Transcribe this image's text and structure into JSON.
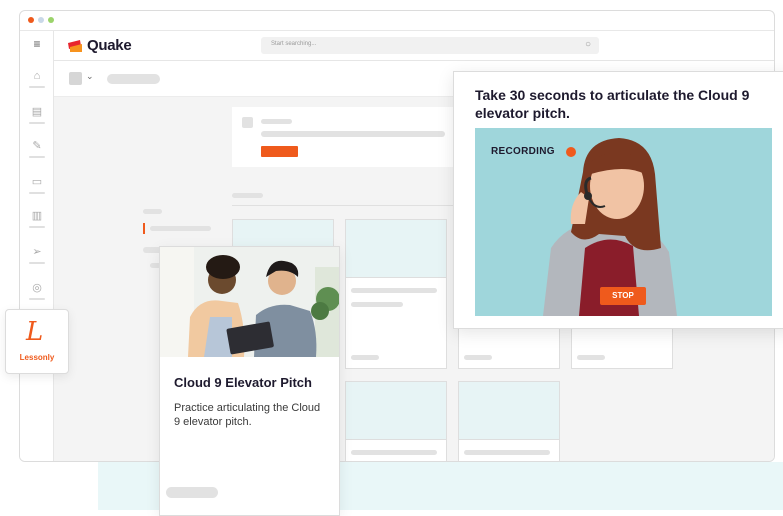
{
  "header": {
    "logo_text": "Quake",
    "search_placeholder": "Start searching..."
  },
  "hero_card": {
    "title": "Cloud 9 Elevator Pitch",
    "description": "Practice articulating the Cloud 9 elevator pitch."
  },
  "lessonly": {
    "logo_letter": "L",
    "label": "Lessonly"
  },
  "recording_panel": {
    "title": "Take 30 seconds to articulate the Cloud 9 elevator pitch.",
    "status_label": "RECORDING",
    "stop_label": "STOP"
  },
  "colors": {
    "brand_orange": "#ef5a1c",
    "brand_red": "#e8262d",
    "video_bg": "#9fd6db",
    "card_teal": "#e7f4f5",
    "text_dark": "#1e1a2e"
  },
  "icons": [
    "hamburger-menu-icon",
    "home-icon",
    "document-icon",
    "pencil-icon",
    "box-icon",
    "bar-chart-icon",
    "paper-plane-icon",
    "chat-icon",
    "search-icon",
    "chevron-down-icon"
  ]
}
